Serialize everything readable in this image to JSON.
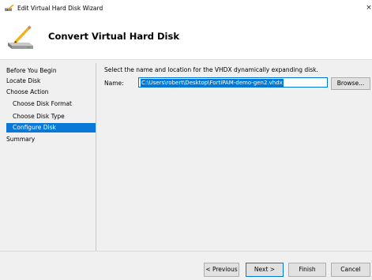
{
  "window": {
    "title": "Edit Virtual Hard Disk Wizard",
    "close_glyph": "×"
  },
  "header": {
    "title": "Convert Virtual Hard Disk",
    "icon": "virtual-disk-pen-icon"
  },
  "nav": {
    "items": [
      {
        "label": "Before You Begin",
        "level": 0,
        "selected": false
      },
      {
        "label": "Locate Disk",
        "level": 0,
        "selected": false
      },
      {
        "label": "Choose Action",
        "level": 0,
        "selected": false
      },
      {
        "label": "Choose Disk Format",
        "level": 1,
        "selected": false
      },
      {
        "label": "Choose Disk Type",
        "level": 1,
        "selected": false
      },
      {
        "label": "Configure Disk",
        "level": 1,
        "selected": true
      },
      {
        "label": "Summary",
        "level": 0,
        "selected": false
      }
    ]
  },
  "main": {
    "instruction": "Select the name and location for the VHDX dynamically expanding disk.",
    "name_label": "Name:",
    "path_value": "C:\\Users\\robert\\Desktop\\FortiPAM-demo-gen2.vhdx",
    "browse_label": "Browse..."
  },
  "footer": {
    "previous_label": "< Previous",
    "next_label": "Next >",
    "finish_label": "Finish",
    "cancel_label": "Cancel"
  },
  "colors": {
    "accent": "#0a78d7",
    "background": "#f0f0f0",
    "header_background": "#ffffff"
  }
}
